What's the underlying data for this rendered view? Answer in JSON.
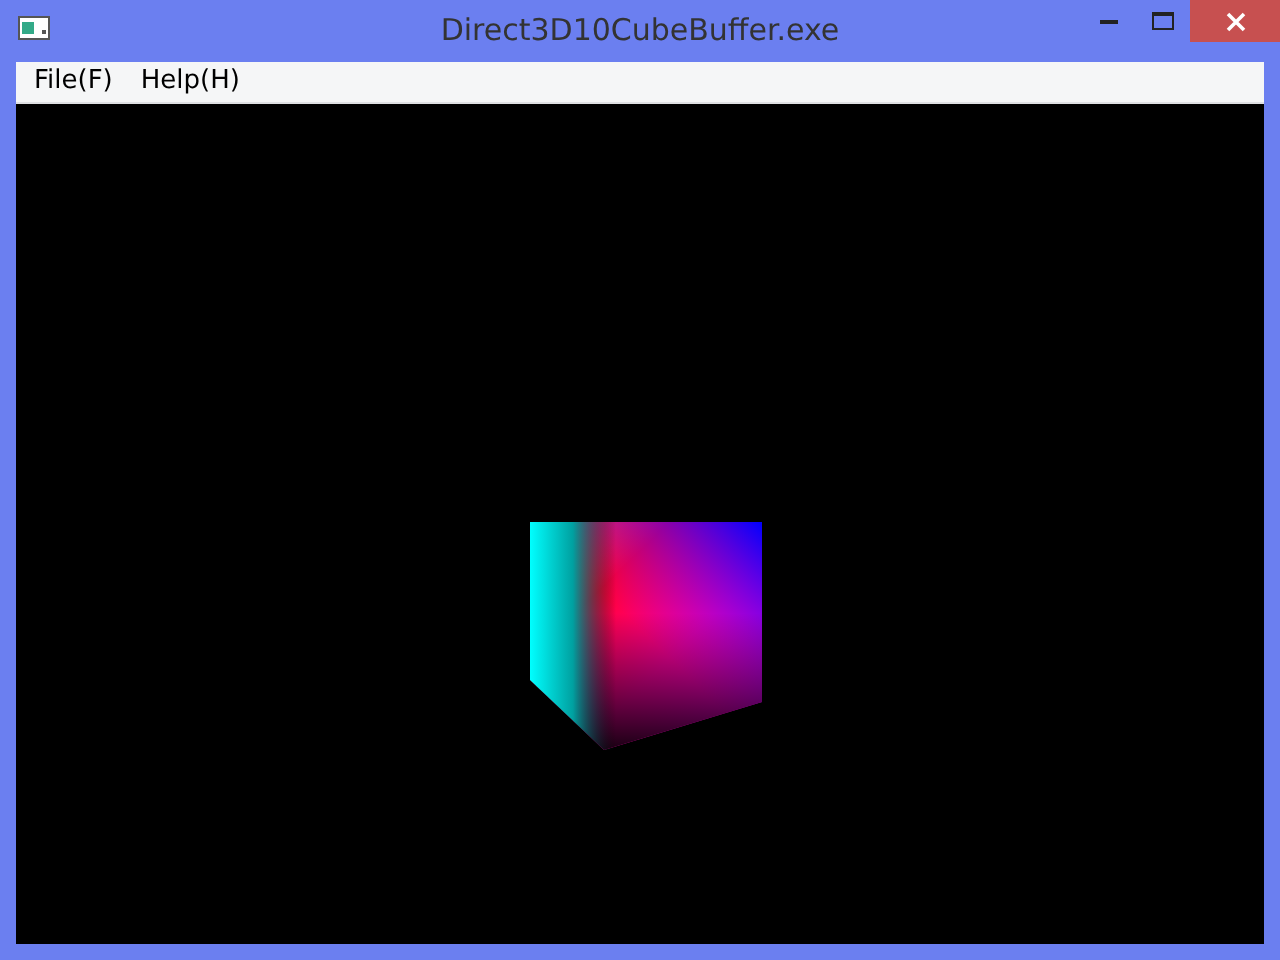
{
  "window": {
    "title": "Direct3D10CubeBuffer.exe"
  },
  "menu": [
    {
      "label": "File(F)"
    },
    {
      "label": "Help(H)"
    }
  ]
}
